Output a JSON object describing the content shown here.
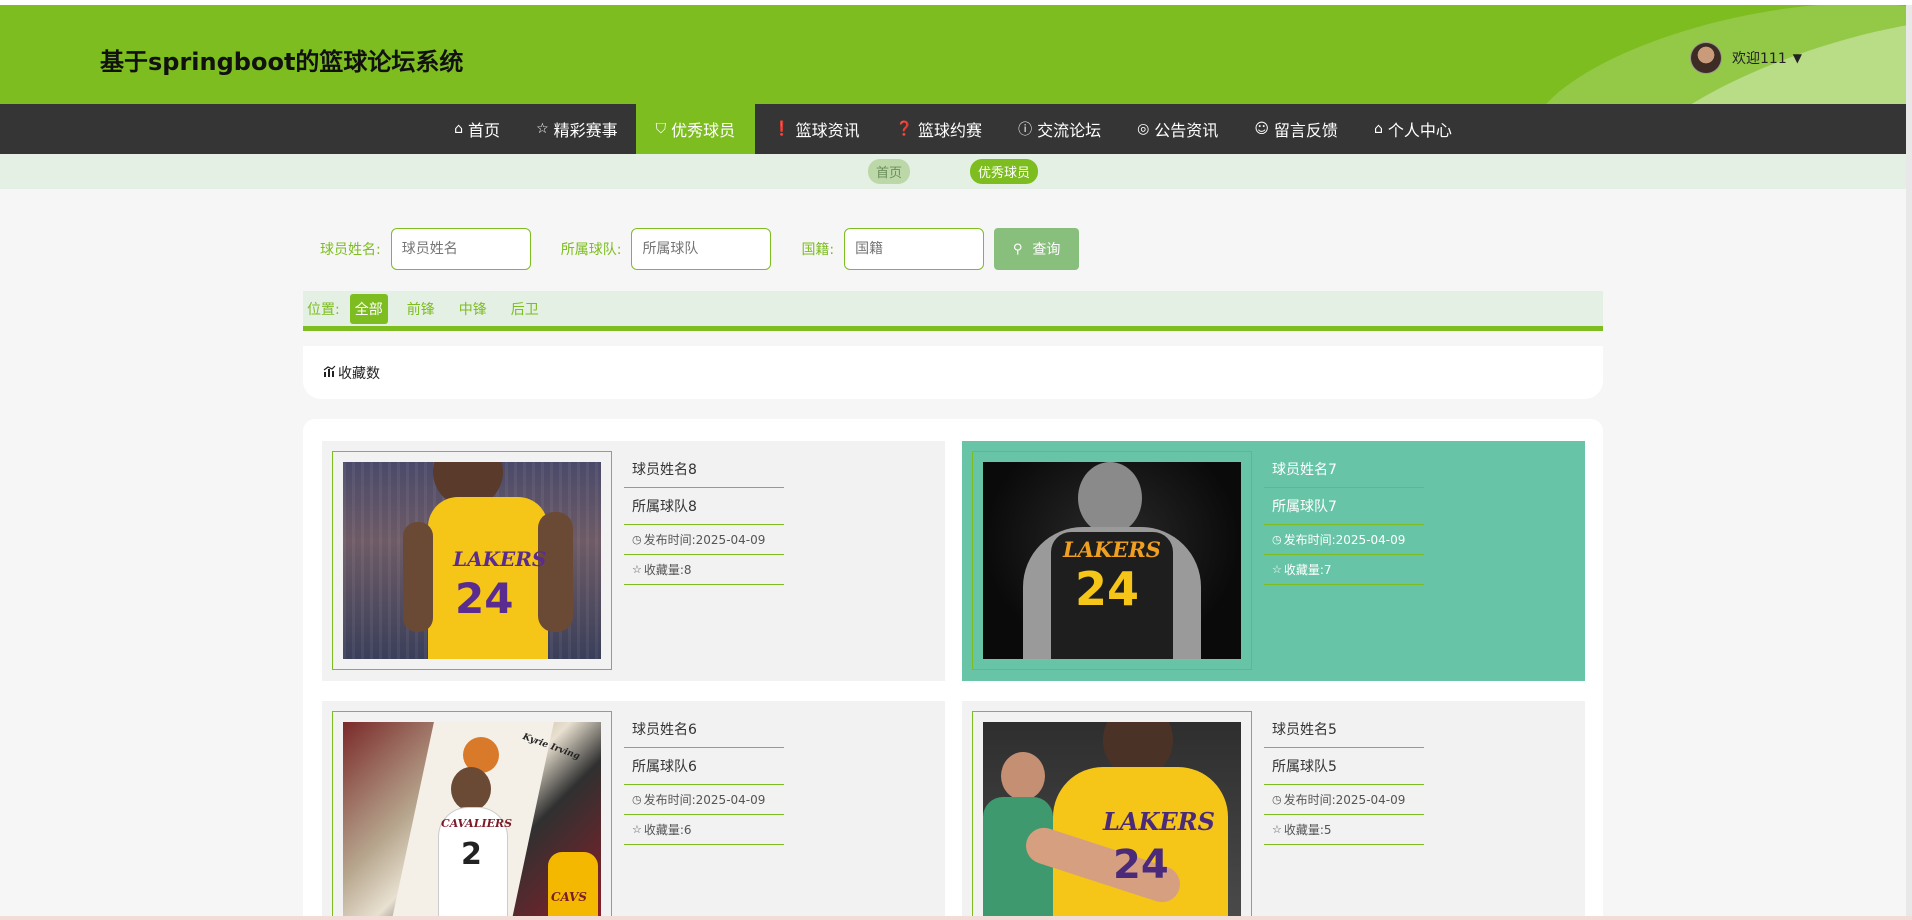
{
  "header": {
    "title": "基于springboot的篮球论坛系统",
    "welcome": "欢迎111",
    "caret": "▼"
  },
  "nav": {
    "items": [
      {
        "label": "首页",
        "icon": "⌂"
      },
      {
        "label": "精彩赛事",
        "icon": "☆"
      },
      {
        "label": "优秀球员",
        "icon": "⛉"
      },
      {
        "label": "篮球资讯",
        "icon": "❗"
      },
      {
        "label": "篮球约赛",
        "icon": "❓"
      },
      {
        "label": "交流论坛",
        "icon": "ⓘ"
      },
      {
        "label": "公告资讯",
        "icon": "◎"
      },
      {
        "label": "留言反馈",
        "icon": "☺"
      },
      {
        "label": "个人中心",
        "icon": "⌂"
      }
    ],
    "active": "优秀球员"
  },
  "breadcrumb": {
    "home": "首页",
    "current": "优秀球员"
  },
  "search": {
    "name_label": "球员姓名:",
    "name_placeholder": "球员姓名",
    "team_label": "所属球队:",
    "team_placeholder": "所属球队",
    "nation_label": "国籍:",
    "nation_placeholder": "国籍",
    "button": "查询"
  },
  "filter": {
    "label": "位置:",
    "options": [
      "全部",
      "前锋",
      "中锋",
      "后卫"
    ],
    "selected": "全部"
  },
  "sort": {
    "label": "收藏数"
  },
  "cards": [
    {
      "name": "球员姓名8",
      "team": "所属球队8",
      "date_label": "发布时间:",
      "date": "2025-04-09",
      "fav_label": "收藏量:",
      "fav": "8"
    },
    {
      "name": "球员姓名7",
      "team": "所属球队7",
      "date_label": "发布时间:",
      "date": "2025-04-09",
      "fav_label": "收藏量:",
      "fav": "7"
    },
    {
      "name": "球员姓名6",
      "team": "所属球队6",
      "date_label": "发布时间:",
      "date": "2025-04-09",
      "fav_label": "收藏量:",
      "fav": "6"
    },
    {
      "name": "球员姓名5",
      "team": "所属球队5",
      "date_label": "发布时间:",
      "date": "2025-04-09",
      "fav_label": "收藏量:",
      "fav": "5"
    }
  ],
  "photo_text": {
    "lakers": "LAKERS",
    "num24": "24",
    "num2": "2",
    "cavs": "CAVS",
    "cavaliers": "CAVALIERS",
    "kyrie": "Kyrie Irving"
  },
  "colors": {
    "primary": "#7dbd1f",
    "nav_bg": "#353535",
    "hover_card": "#68c4a6",
    "button": "#88bf7d"
  }
}
